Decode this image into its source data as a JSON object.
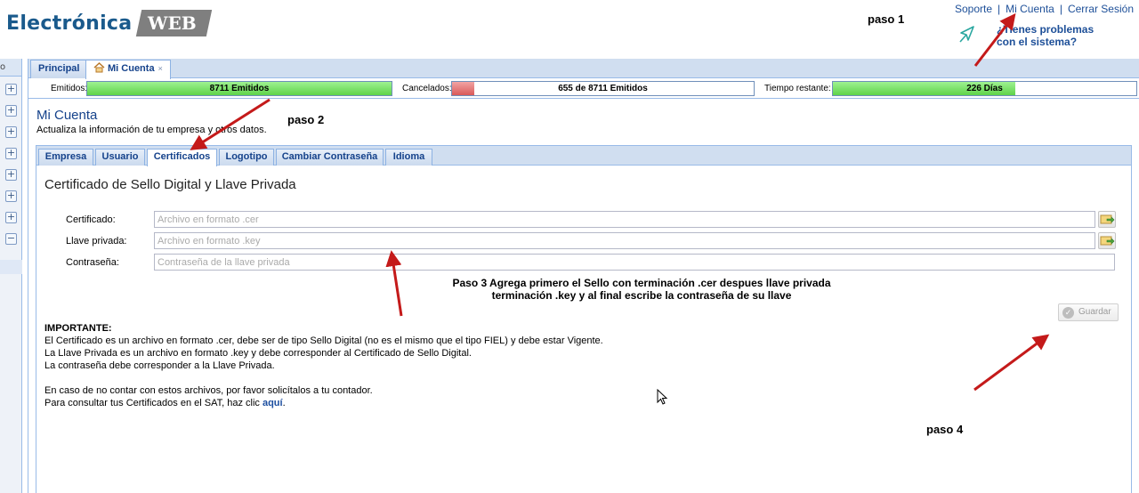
{
  "brand": {
    "name": "Electrónica",
    "tag": "WEB"
  },
  "toplinks": {
    "soporte": "Soporte",
    "mi_cuenta": "Mi Cuenta",
    "cerrar": "Cerrar Sesión",
    "sep": "|"
  },
  "help": {
    "line1": "¿Tienes problemas",
    "line2": "con el sistema?"
  },
  "annotations": {
    "paso1": "paso 1",
    "paso2": "paso 2",
    "paso4": "paso 4",
    "paso3_line1": "Paso 3 Agrega primero el Sello con terminación .cer despues llave privada",
    "paso3_line2": "terminación .key y al final escribe la contraseña de su llave"
  },
  "sidebar": {
    "header": "o"
  },
  "main_tabs": [
    {
      "label": "Principal"
    },
    {
      "label": "Mi Cuenta",
      "close": "×"
    }
  ],
  "stats": {
    "emitidos": {
      "label": "Emitidos:",
      "text": "8711 Emitidos",
      "fraction": 1.0
    },
    "cancelados": {
      "label": "Cancelados:",
      "text": "655 de 8711 Emitidos",
      "fraction": 0.075
    },
    "tiempo": {
      "label": "Tiempo restante:",
      "text": "226 Días",
      "fraction": 0.6
    }
  },
  "page": {
    "title": "Mi Cuenta",
    "subtitle": "Actualiza la información de tu empresa y otros datos."
  },
  "form_tabs": [
    {
      "label": "Empresa"
    },
    {
      "label": "Usuario"
    },
    {
      "label": "Certificados",
      "active": true
    },
    {
      "label": "Logotipo"
    },
    {
      "label": "Cambiar Contraseña"
    },
    {
      "label": "Idioma"
    }
  ],
  "form": {
    "title": "Certificado de Sello Digital y Llave Privada",
    "certificado": {
      "label": "Certificado:",
      "placeholder": "Archivo en formato .cer",
      "value": ""
    },
    "llave": {
      "label": "Llave privada:",
      "placeholder": "Archivo en formato .key",
      "value": ""
    },
    "contrasena": {
      "label": "Contraseña:",
      "placeholder": "Contraseña de la llave privada",
      "value": ""
    },
    "save_label": "Guardar"
  },
  "important": {
    "heading": "IMPORTANTE:",
    "line1": "El Certificado es un archivo en formato .cer, debe ser de tipo Sello Digital (no es el mismo que el tipo FIEL) y debe estar Vigente.",
    "line2": "La Llave Privada es un archivo en formato .key y debe corresponder al Certificado de Sello Digital.",
    "line3": "La contraseña debe corresponder a la Llave Privada.",
    "line4": "En caso de no contar con estos archivos, por favor solicítalos a tu contador.",
    "line5_prefix": "Para consultar tus Certificados en el SAT, haz clic ",
    "line5_link": "aquí",
    "line5_suffix": "."
  },
  "colors": {
    "accent": "#15428b",
    "arrow": "#c41a1a",
    "bar_green": "#5fd34a",
    "bar_red": "#d95a5a"
  }
}
